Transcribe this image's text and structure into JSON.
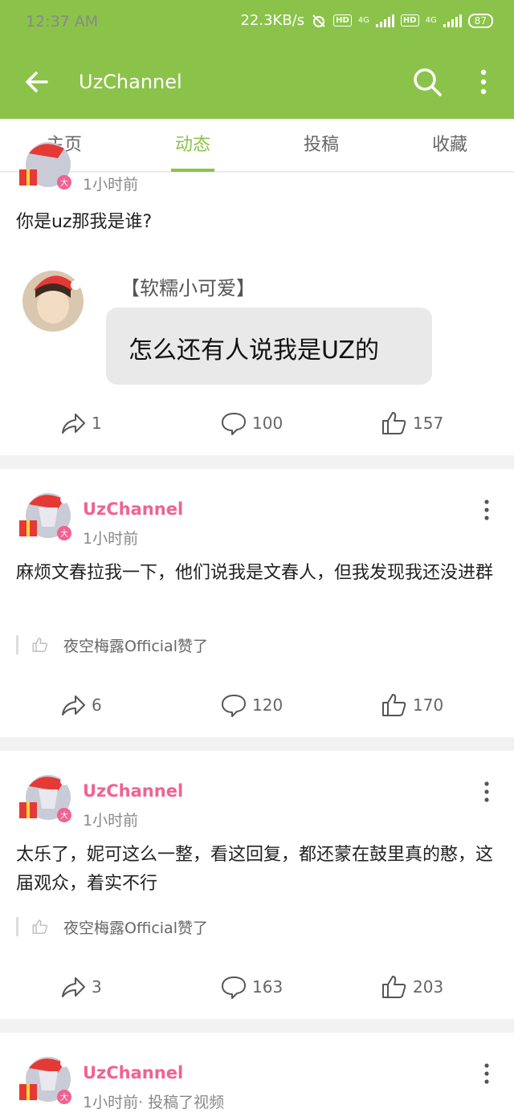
{
  "status": {
    "time": "12:37 AM",
    "speed": "22.3KB/s",
    "hd1": "HD",
    "hd2": "HD",
    "net1": "4G",
    "net2": "4G",
    "battery": "87"
  },
  "appbar": {
    "title": "UzChannel"
  },
  "tabs": [
    {
      "label": "主页"
    },
    {
      "label": "动态"
    },
    {
      "label": "投稿"
    },
    {
      "label": "收藏"
    }
  ],
  "posts": [
    {
      "time": "1小时前",
      "text": "你是uz那我是谁?",
      "image": {
        "name": "【软糯小可爱】",
        "bubble": "怎么还有人说我是UZ的"
      },
      "shares": "1",
      "comments": "100",
      "likes": "157"
    },
    {
      "author": "UzChannel",
      "time": "1小时前",
      "text": "麻烦文春拉我一下，他们说我是文春人，但我发现我还没进群",
      "liked_by": "夜空梅露Official赞了",
      "shares": "6",
      "comments": "120",
      "likes": "170"
    },
    {
      "author": "UzChannel",
      "time": "1小时前",
      "text": "太乐了，妮可这么一整，看这回复，都还蒙在鼓里真的憨，这届观众，着实不行",
      "liked_by": "夜空梅露Official赞了",
      "shares": "3",
      "comments": "163",
      "likes": "203"
    },
    {
      "author": "UzChannel",
      "time": "1小时前· 投稿了视频"
    }
  ],
  "colors": {
    "brand": "#8bc34a",
    "author": "#f06292"
  }
}
